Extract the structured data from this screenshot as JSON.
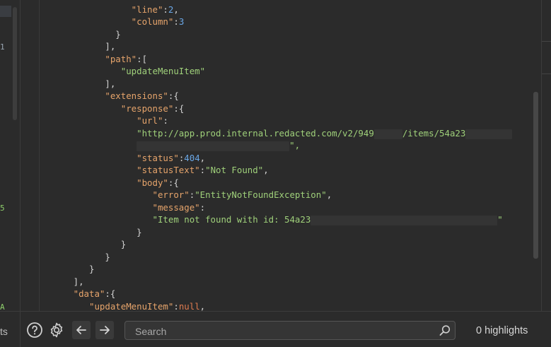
{
  "gutter_markers": {
    "m1": "1",
    "m2": "5",
    "m3": "A"
  },
  "code": {
    "l1_key": "\"line\"",
    "l1_val": "2",
    "l2_key": "\"column\"",
    "l2_val": "3",
    "close_brace": "}",
    "close_bracket": "],",
    "path_key": "\"path\"",
    "path_item": "\"updateMenuItem\"",
    "extensions_key": "\"extensions\"",
    "response_key": "\"response\"",
    "url_key": "\"url\"",
    "url_val_a": "\"http://app.prod.internal.redacted.com/v2/949",
    "url_val_b": "/items/54a23",
    "url_tail": "\",",
    "status_key": "\"status\"",
    "status_val": "404",
    "statusText_key": "\"statusText\"",
    "statusText_val": "\"Not Found\"",
    "body_key": "\"body\"",
    "error_key": "\"error\"",
    "error_val": "\"EntityNotFoundException\"",
    "message_key": "\"message\"",
    "message_val": "\"Item not found with id: 54a23",
    "message_tail": "\"",
    "data_key": "\"data\"",
    "update_key": "\"updateMenuItem\"",
    "update_val": "null"
  },
  "bottom": {
    "left_partial_text": "ts",
    "search_placeholder": "Search",
    "highlights": "0 highlights"
  },
  "colors": {
    "accent": "#e8762d",
    "key": "#e6a46b",
    "string": "#9fd07a",
    "number": "#6aa7e6"
  }
}
